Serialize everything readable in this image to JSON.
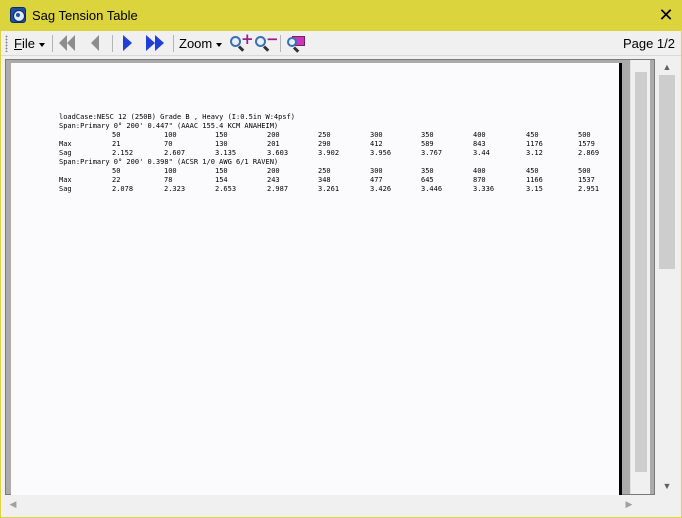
{
  "window": {
    "title": "Sag Tension Table",
    "close_glyph": "✕"
  },
  "toolbar": {
    "file_label": "File",
    "file_accel": "F",
    "file_rest": "ile",
    "zoom_label": "Zoom",
    "page_indicator": "Page 1/2",
    "icons": [
      "first-page-icon",
      "previous-page-icon",
      "next-page-icon",
      "last-page-icon",
      "zoom-in-icon",
      "zoom-out-icon",
      "find-icon"
    ]
  },
  "colors": {
    "title_bar": "#dcd43c",
    "nav_blue": "#1f3fd6",
    "nav_gray": "#8d8d8d",
    "zoom_sign": "#9a1f8d"
  },
  "report": {
    "load_case": "loadCase:NESC  12  (250B)  Grade  B , Heavy  (I:0.5in  W:4psf)",
    "sections": [
      {
        "span": "Span:Primary  0° 200'  0.447\"  (AAAC 155.4  KCM ANAHEIM)",
        "header": [
          "50",
          "100",
          "150",
          "200",
          "250",
          "300",
          "350",
          "400",
          "450",
          "500"
        ],
        "rows": [
          {
            "label": "Max",
            "values": [
              "21",
              "70",
              "130",
              "201",
              "290",
              "412",
              "589",
              "843",
              "1176",
              "1579"
            ]
          },
          {
            "label": "Sag",
            "values": [
              "2.152",
              "2.607",
              "3.135",
              "3.603",
              "3.902",
              "3.956",
              "3.767",
              "3.44",
              "3.12",
              "2.869"
            ]
          }
        ]
      },
      {
        "span": "Span:Primary  0° 200'  0.398\"  (ACSR 1/0  AWG 6/1  RAVEN)",
        "header": [
          "50",
          "100",
          "150",
          "200",
          "250",
          "300",
          "350",
          "400",
          "450",
          "500"
        ],
        "rows": [
          {
            "label": "Max",
            "values": [
              "22",
              "78",
              "154",
              "243",
              "348",
              "477",
              "645",
              "870",
              "1166",
              "1537"
            ]
          },
          {
            "label": "Sag",
            "values": [
              "2.078",
              "2.323",
              "2.653",
              "2.987",
              "3.261",
              "3.426",
              "3.446",
              "3.336",
              "3.15",
              "2.951"
            ]
          }
        ]
      }
    ]
  }
}
